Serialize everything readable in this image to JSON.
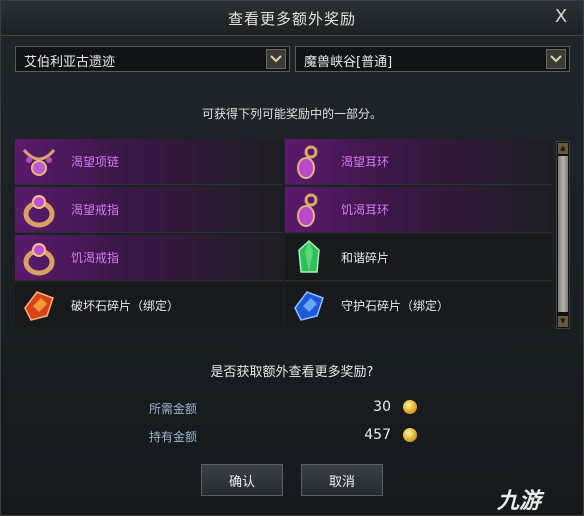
{
  "dialog": {
    "title": "查看更多额外奖励",
    "close_glyph": "X"
  },
  "selects": {
    "dungeon": "艾伯利亚古遗迹",
    "difficulty": "魔兽峡谷[普通]"
  },
  "info_text": "可获得下列可能奖励中的一部分。",
  "rewards": [
    {
      "name": "渴望项链",
      "icon": "necklace-icon",
      "rarity": "epic"
    },
    {
      "name": "渴望耳环",
      "icon": "earring-icon",
      "rarity": "epic"
    },
    {
      "name": "渴望戒指",
      "icon": "ring-icon",
      "rarity": "epic"
    },
    {
      "name": "饥渴耳环",
      "icon": "earring-icon",
      "rarity": "epic"
    },
    {
      "name": "饥渴戒指",
      "icon": "ring-icon",
      "rarity": "epic"
    },
    {
      "name": "和谐碎片",
      "icon": "green-crystal-icon",
      "rarity": "plain"
    },
    {
      "name": "破坏石碎片（绑定）",
      "icon": "red-stone-icon",
      "rarity": "plain"
    },
    {
      "name": "守护石碎片（绑定）",
      "icon": "blue-stone-icon",
      "rarity": "plain"
    }
  ],
  "question": "是否获取额外查看更多奖励?",
  "cost": {
    "label": "所需金额",
    "value": "30"
  },
  "owned": {
    "label": "持有金额",
    "value": "457"
  },
  "buttons": {
    "confirm": "确认",
    "cancel": "取消"
  },
  "watermark": "九游",
  "colors": {
    "epic": "#d67cf0",
    "label": "#a0b4cc",
    "gold": "#e0a822"
  }
}
